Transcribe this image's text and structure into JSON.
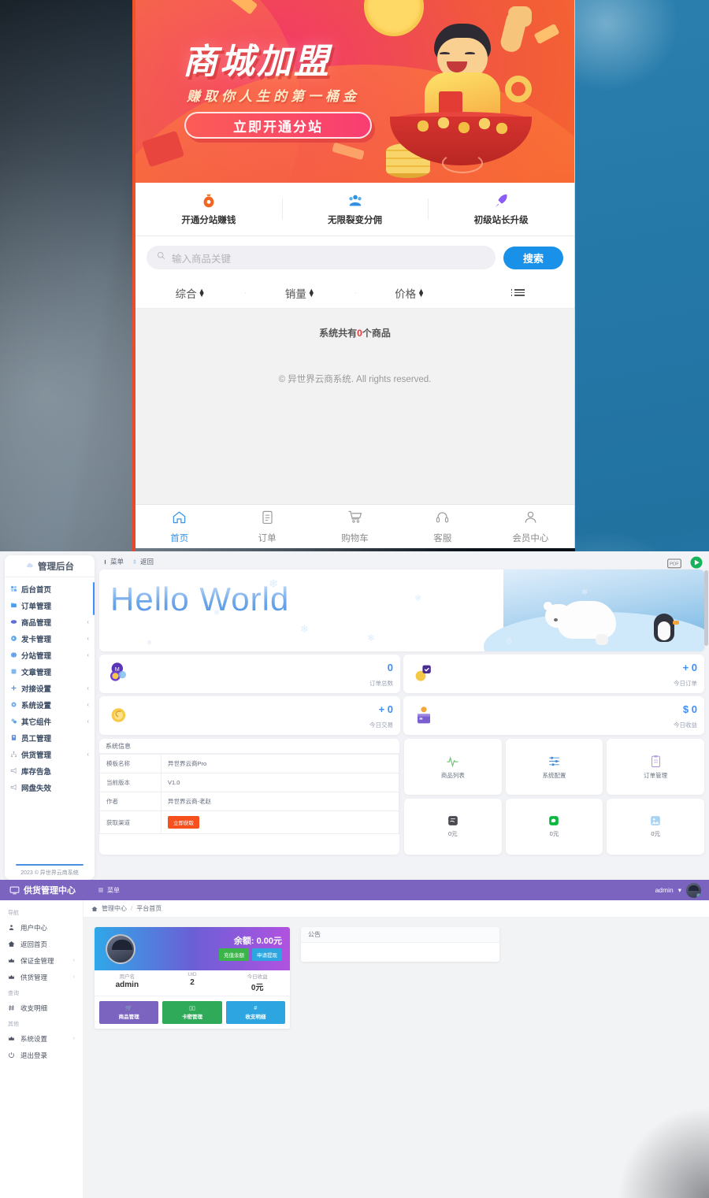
{
  "mobile": {
    "banner": {
      "title": "商城加盟",
      "subtitle": "赚取你人生的第一桶金",
      "cta": "立即开通分站"
    },
    "features": [
      {
        "label": "开通分站赚钱",
        "icon": "money-bag-icon"
      },
      {
        "label": "无限裂变分佣",
        "icon": "users-group-icon"
      },
      {
        "label": "初级站长升级",
        "icon": "rocket-icon"
      }
    ],
    "search": {
      "placeholder": "输入商品关键",
      "button": "搜索",
      "icon": "search-icon"
    },
    "sorts": [
      {
        "label": "综合"
      },
      {
        "label": "销量"
      },
      {
        "label": "价格"
      }
    ],
    "count_prefix": "系统共有",
    "count_value": "0",
    "count_suffix": "个商品",
    "copyright": "© 异世界云商系统. All rights reserved.",
    "tabs": [
      {
        "label": "首页",
        "icon": "home-icon",
        "active": true
      },
      {
        "label": "订单",
        "icon": "clipboard-icon",
        "active": false
      },
      {
        "label": "购物车",
        "icon": "cart-icon",
        "active": false
      },
      {
        "label": "客服",
        "icon": "headset-icon",
        "active": false
      },
      {
        "label": "会员中心",
        "icon": "user-icon",
        "active": false
      }
    ]
  },
  "admin": {
    "logo": "管理后台",
    "menu": [
      {
        "label": "后台首页",
        "arrow": ""
      },
      {
        "label": "订单管理",
        "arrow": ""
      },
      {
        "label": "商品管理",
        "arrow": "‹"
      },
      {
        "label": "发卡管理",
        "arrow": "‹"
      },
      {
        "label": "分站管理",
        "arrow": "‹"
      },
      {
        "label": "文章管理",
        "arrow": ""
      },
      {
        "label": "对接设置",
        "arrow": "‹"
      },
      {
        "label": "系统设置",
        "arrow": "‹"
      },
      {
        "label": "其它组件",
        "arrow": "‹"
      },
      {
        "label": "员工管理",
        "arrow": ""
      },
      {
        "label": "供货管理",
        "arrow": "‹"
      },
      {
        "label": "库存告急",
        "arrow": ""
      },
      {
        "label": "网盘失效",
        "arrow": ""
      }
    ],
    "sidebar_footer": "2023 © 异世界云商系统",
    "topbar": {
      "menu": "菜单",
      "back": "返回"
    },
    "hero_text": "Hello World",
    "stats": [
      {
        "value": "0",
        "label": "订单总数",
        "icon": "coins-badge-icon"
      },
      {
        "value": "+ 0",
        "label": "今日订单",
        "icon": "coin-check-icon"
      },
      {
        "value": "+ 0",
        "label": "今日交易",
        "icon": "coin-icon"
      },
      {
        "value": "$ 0",
        "label": "今日收益",
        "icon": "wallet-icon"
      }
    ],
    "sysinfo": {
      "title": "系统信息",
      "rows": [
        {
          "key": "模板名称",
          "value": "异世界云商Pro"
        },
        {
          "key": "当前版本",
          "value": "V1.0"
        },
        {
          "key": "作者",
          "value": "异世界云商-老赵"
        },
        {
          "key": "获取渠道",
          "value": ""
        }
      ],
      "get_button": "立即获取"
    },
    "tiles": [
      {
        "label": "商品列表",
        "icon": "pulse-icon"
      },
      {
        "label": "系统配置",
        "icon": "sliders-icon"
      },
      {
        "label": "订单管理",
        "icon": "clipboard-icon"
      },
      {
        "label": "0元",
        "icon": "alipay-icon"
      },
      {
        "label": "0元",
        "icon": "wechat-pay-icon"
      },
      {
        "label": "0元",
        "icon": "qq-pay-icon"
      }
    ]
  },
  "supply": {
    "title": "供货管理中心",
    "menu_label": "菜单",
    "user": "admin",
    "breadcrumb": {
      "root": "管理中心",
      "current": "平台首页"
    },
    "groups": [
      {
        "name": "导航",
        "items": [
          {
            "label": "用户中心",
            "icon": "person-icon",
            "arrow": ""
          },
          {
            "label": "返回首页",
            "icon": "home-icon",
            "arrow": ""
          },
          {
            "label": "保证金管理",
            "icon": "crown-icon",
            "arrow": "›"
          },
          {
            "label": "供货管理",
            "icon": "crown-icon",
            "arrow": "›"
          }
        ]
      },
      {
        "name": "查询",
        "items": [
          {
            "label": "收支明细",
            "icon": "hash-icon",
            "arrow": ""
          }
        ]
      },
      {
        "name": "其他",
        "items": [
          {
            "label": "系统设置",
            "icon": "crown-icon",
            "arrow": "›"
          },
          {
            "label": "退出登录",
            "icon": "power-icon",
            "arrow": ""
          }
        ]
      }
    ],
    "user_card": {
      "balance_label": "余额:",
      "balance_value": "0.00元",
      "recharge_button": "充值余额",
      "withdraw_button": "申请提现",
      "stats": [
        {
          "key": "用户名",
          "value": "admin"
        },
        {
          "key": "UID",
          "value": "2"
        },
        {
          "key": "今日收益",
          "value": "0元"
        }
      ],
      "actions": [
        {
          "label": "商品管理",
          "icon": "cart-icon",
          "color": "#7b63c0"
        },
        {
          "label": "卡密管理",
          "icon": "card-icon",
          "color": "#2eaa58"
        },
        {
          "label": "收支明细",
          "icon": "hash-icon",
          "color": "#2ca5e0"
        }
      ]
    },
    "notice": {
      "title": "公告",
      "body": ""
    }
  },
  "colors": {
    "brand_blue": "#1a91e8",
    "admin_accent": "#3e8ef7",
    "supply_purple": "#7b63c0",
    "red_accent": "#e4393c",
    "orange_btn": "#f5501e"
  }
}
